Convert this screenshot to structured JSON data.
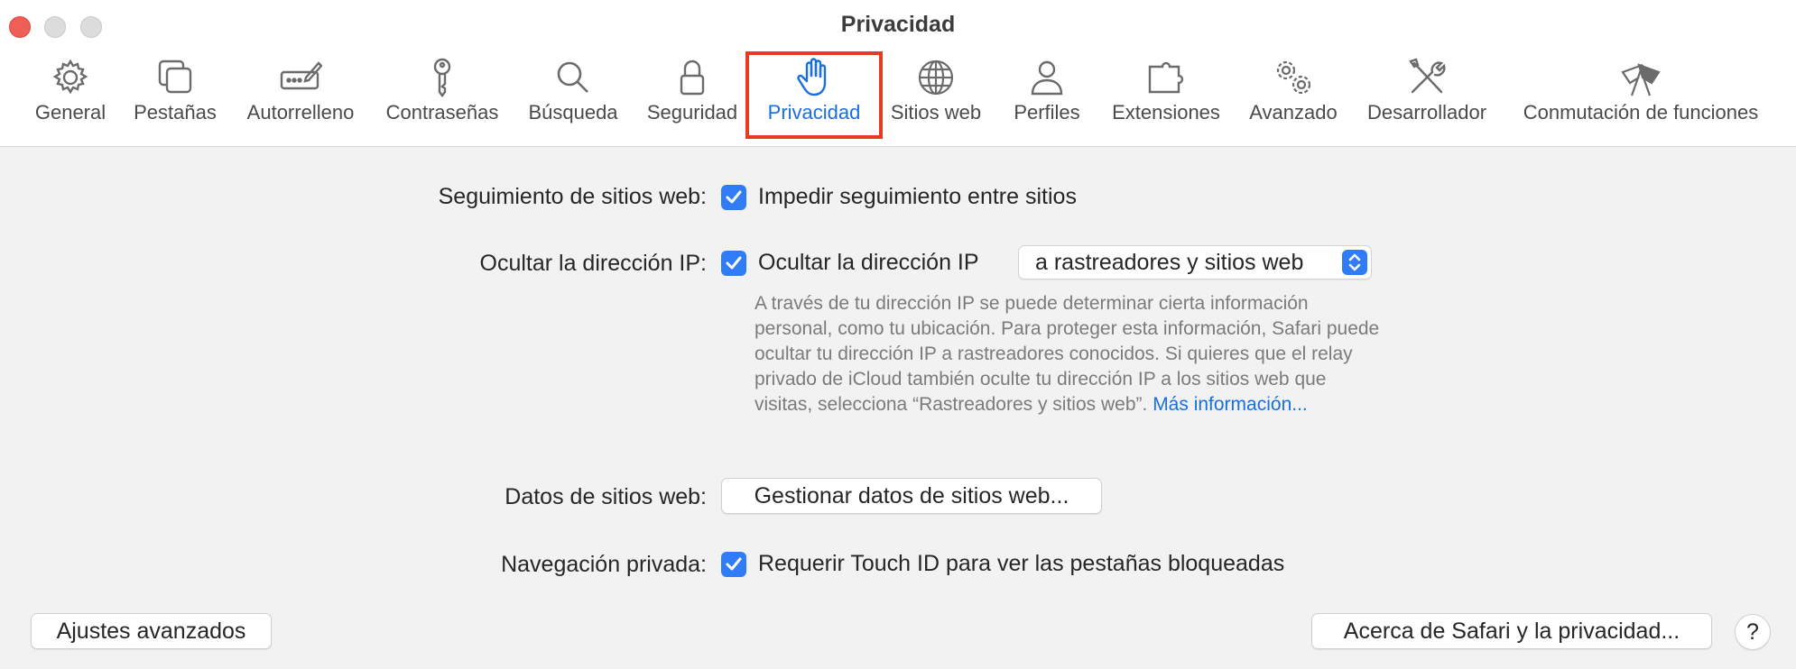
{
  "window": {
    "title": "Privacidad"
  },
  "toolbar": {
    "tabs": [
      {
        "label": "General",
        "icon": "gear-icon"
      },
      {
        "label": "Pestañas",
        "icon": "tabs-icon"
      },
      {
        "label": "Autorrelleno",
        "icon": "autofill-icon"
      },
      {
        "label": "Contraseñas",
        "icon": "key-icon"
      },
      {
        "label": "Búsqueda",
        "icon": "search-icon"
      },
      {
        "label": "Seguridad",
        "icon": "lock-icon"
      },
      {
        "label": "Privacidad",
        "icon": "hand-icon"
      },
      {
        "label": "Sitios web",
        "icon": "globe-icon"
      },
      {
        "label": "Perfiles",
        "icon": "person-icon"
      },
      {
        "label": "Extensiones",
        "icon": "puzzle-icon"
      },
      {
        "label": "Avanzado",
        "icon": "gears-icon"
      },
      {
        "label": "Desarrollador",
        "icon": "tools-icon"
      },
      {
        "label": "Conmutación de funciones",
        "icon": "flags-icon"
      }
    ],
    "selected": "Privacidad"
  },
  "tracking": {
    "label": "Seguimiento de sitios web:",
    "checkbox_label": "Impedir seguimiento entre sitios",
    "checked": true
  },
  "hide_ip": {
    "label": "Ocultar la dirección IP:",
    "checkbox_label": "Ocultar la dirección IP",
    "checked": true,
    "popup_value": "a rastreadores y sitios web",
    "description": "A través de tu dirección IP se puede determinar cierta información personal, como tu ubicación. Para proteger esta información, Safari puede ocultar tu dirección IP a rastreadores conocidos. Si quieres que el relay privado de iCloud también oculte tu dirección IP a los sitios web que visitas, selecciona “Rastreadores y sitios web”.",
    "more_link": "Más información..."
  },
  "website_data": {
    "label": "Datos de sitios web:",
    "button_label": "Gestionar datos de sitios web..."
  },
  "private_browsing": {
    "label": "Navegación privada:",
    "checkbox_label": "Requerir Touch ID para ver las pestañas bloqueadas",
    "checked": true
  },
  "footer": {
    "advanced_button": "Ajustes avanzados",
    "about_button": "Acerca de Safari y la privacidad...",
    "help_button": "?"
  },
  "colors": {
    "accent": "#2f7cf6",
    "link": "#1a6fe0",
    "highlight": "#e63a22"
  }
}
